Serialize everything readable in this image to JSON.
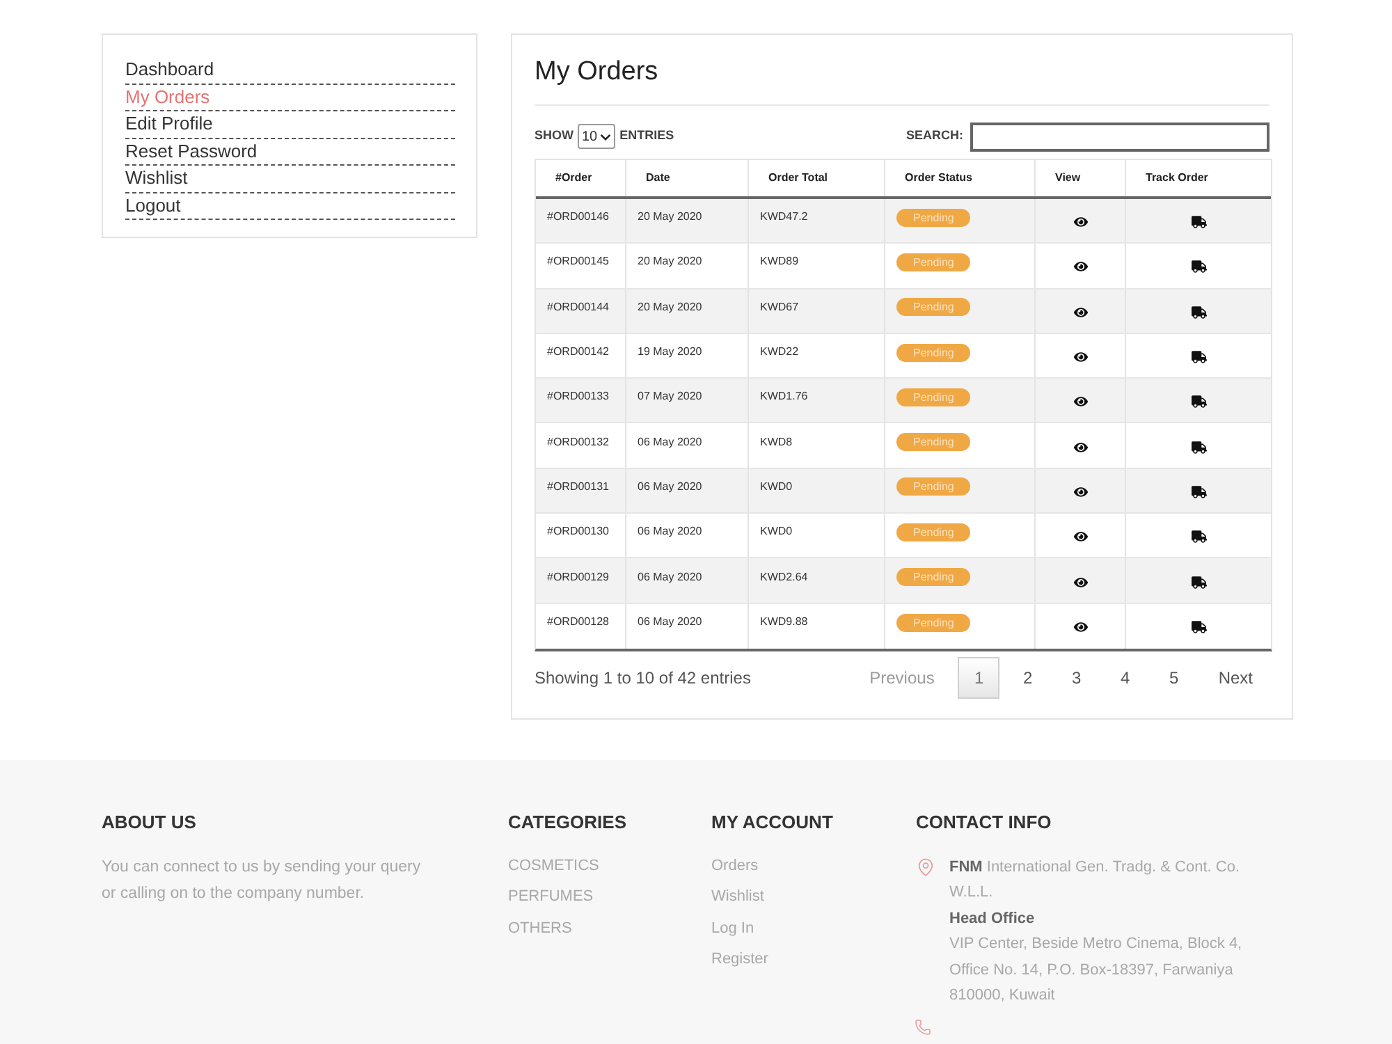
{
  "sidebar": {
    "items": [
      {
        "label": "Dashboard",
        "selected": false
      },
      {
        "label": "My Orders",
        "selected": true
      },
      {
        "label": "Edit Profile",
        "selected": false
      },
      {
        "label": "Reset Password",
        "selected": false
      },
      {
        "label": "Wishlist",
        "selected": false
      },
      {
        "label": "Logout",
        "selected": false
      }
    ]
  },
  "orders": {
    "title": "My Orders",
    "length_control": {
      "before": "SHOW",
      "value": "10",
      "after": "ENTRIES"
    },
    "search": {
      "label": "SEARCH:"
    },
    "table": {
      "columns": [
        "#Order",
        "Date",
        "Order Total",
        "Order Status",
        "View",
        "Track Order"
      ],
      "rows": [
        {
          "order": "#ORD00146",
          "date": "20 May 2020",
          "total": "KWD47.2",
          "status": "Pending"
        },
        {
          "order": "#ORD00145",
          "date": "20 May 2020",
          "total": "KWD89",
          "status": "Pending"
        },
        {
          "order": "#ORD00144",
          "date": "20 May 2020",
          "total": "KWD67",
          "status": "Pending"
        },
        {
          "order": "#ORD00142",
          "date": "19 May 2020",
          "total": "KWD22",
          "status": "Pending"
        },
        {
          "order": "#ORD00133",
          "date": "07 May 2020",
          "total": "KWD1.76",
          "status": "Pending"
        },
        {
          "order": "#ORD00132",
          "date": "06 May 2020",
          "total": "KWD8",
          "status": "Pending"
        },
        {
          "order": "#ORD00131",
          "date": "06 May 2020",
          "total": "KWD0",
          "status": "Pending"
        },
        {
          "order": "#ORD00130",
          "date": "06 May 2020",
          "total": "KWD0",
          "status": "Pending"
        },
        {
          "order": "#ORD00129",
          "date": "06 May 2020",
          "total": "KWD2.64",
          "status": "Pending"
        },
        {
          "order": "#ORD00128",
          "date": "06 May 2020",
          "total": "KWD9.88",
          "status": "Pending"
        }
      ]
    },
    "info": "Showing 1 to 10 of 42 entries",
    "pagination": {
      "previous": {
        "label": "Previous",
        "disabled": true
      },
      "pages": [
        {
          "label": "1",
          "selected": true
        },
        {
          "label": "2",
          "selected": false
        },
        {
          "label": "3",
          "selected": false
        },
        {
          "label": "4",
          "selected": false
        },
        {
          "label": "5",
          "selected": false
        }
      ],
      "next": {
        "label": "Next",
        "disabled": false
      }
    }
  },
  "footer": {
    "about": {
      "title": "ABOUT US",
      "text": "You can connect to us by sending your query or calling on to the company number."
    },
    "categories": {
      "title": "CATEGORIES",
      "links": [
        "COSMETICS",
        "PERFUMES",
        "OTHERS"
      ]
    },
    "account": {
      "title": "MY ACCOUNT",
      "links": [
        "Orders",
        "Wishlist",
        "Log In",
        "Register"
      ]
    },
    "contact": {
      "title": "CONTACT INFO",
      "company": "**FNM** International Gen. Tradg. & Cont. Co. W.L.L.",
      "office_title": "Head Office",
      "address": "VIP Center, Beside Metro Cinema, Block 4, Office No. 14, P.O. Box-18397, Farwaniya 810000, Kuwait"
    }
  }
}
